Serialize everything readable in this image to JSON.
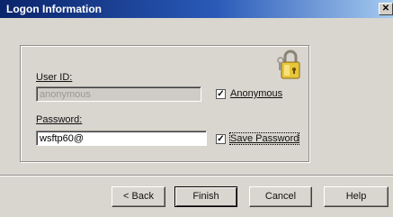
{
  "window": {
    "title": "Logon Information",
    "close_glyph": "✕"
  },
  "form": {
    "user_id_label": "User ID:",
    "user_id_value": "anonymous",
    "anonymous_label": "Anonymous",
    "anonymous_checked": true,
    "password_label": "Password:",
    "password_value": "wsftp60@",
    "save_password_label": "Save Password",
    "save_password_checked": true,
    "check_glyph": "✓"
  },
  "buttons": {
    "back": "< Back",
    "finish": "Finish",
    "cancel": "Cancel",
    "help": "Help"
  },
  "icons": {
    "lock": "padlock-keys-icon"
  },
  "colors": {
    "titlebar_start": "#0a246a",
    "titlebar_end": "#a6caf0",
    "dialog_bg": "#d9d6cf"
  }
}
